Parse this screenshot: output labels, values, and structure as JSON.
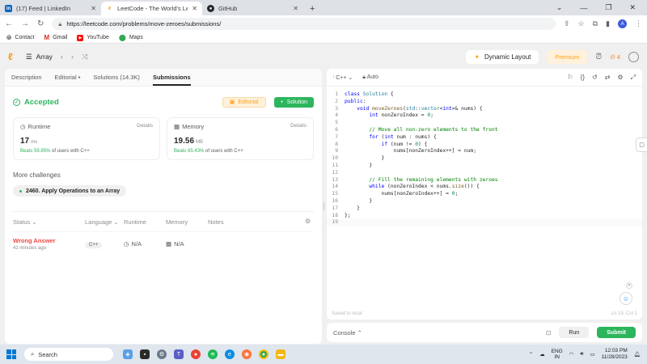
{
  "browser": {
    "tabs": [
      {
        "title": "(17) Feed | LinkedIn",
        "icon": "linkedin-icon",
        "color": "#0a66c2"
      },
      {
        "title": "LeetCode - The World's Leadin",
        "icon": "leetcode-icon",
        "color": "#f89f1b"
      },
      {
        "title": "GitHub",
        "icon": "github-icon",
        "color": "#24292f"
      }
    ],
    "url": "https://leetcode.com/problems/move-zeroes/submissions/",
    "avatar_letter": "A",
    "bookmarks": [
      {
        "label": "Contact",
        "icon": "globe-icon"
      },
      {
        "label": "Gmail",
        "icon": "gmail-icon"
      },
      {
        "label": "YouTube",
        "icon": "youtube-icon"
      },
      {
        "label": "Maps",
        "icon": "maps-icon"
      }
    ]
  },
  "lc_nav": {
    "list_label": "Array",
    "dynamic_layout": "Dynamic Layout",
    "premium": "Premium",
    "streak": "4"
  },
  "left_panel": {
    "tabs": [
      "Description",
      "Editorial",
      "Solutions (14.3K)",
      "Submissions"
    ],
    "status": "Accepted",
    "editorial_btn": "Editorial",
    "solution_btn": "Solution",
    "runtime": {
      "label": "Runtime",
      "details": "Details",
      "value": "17",
      "unit": "ms",
      "beats_pct": "Beats 59.85%",
      "beats_rest": "of users with C++"
    },
    "memory": {
      "label": "Memory",
      "details": "Details",
      "value": "19.56",
      "unit": "MB",
      "beats_pct": "Beats 65.43%",
      "beats_rest": "of users with C++"
    },
    "more_challenges": "More challenges",
    "challenge": "2460. Apply Operations to an Array",
    "table_headers": {
      "status": "Status",
      "language": "Language",
      "runtime": "Runtime",
      "memory": "Memory",
      "notes": "Notes"
    },
    "row": {
      "status": "Wrong Answer",
      "time": "41 minutes ago",
      "language": "C++",
      "runtime": "N/A",
      "memory": "N/A"
    }
  },
  "editor": {
    "language": "C++",
    "auto": "Auto",
    "saved": "Saved to local",
    "position": "Ln 19, Col 1",
    "line_numbers": [
      "1",
      "2",
      "3",
      "4",
      "5",
      "6",
      "7",
      "8",
      "9",
      "10",
      "11",
      "12",
      "13",
      "14",
      "15",
      "16",
      "17",
      "18",
      "19"
    ]
  },
  "console": {
    "label": "Console",
    "run": "Run",
    "submit": "Submit"
  },
  "taskbar": {
    "search": "Search",
    "lang_top": "ENG",
    "lang_bottom": "IN",
    "time": "12:03 PM",
    "date": "11/28/2023"
  }
}
